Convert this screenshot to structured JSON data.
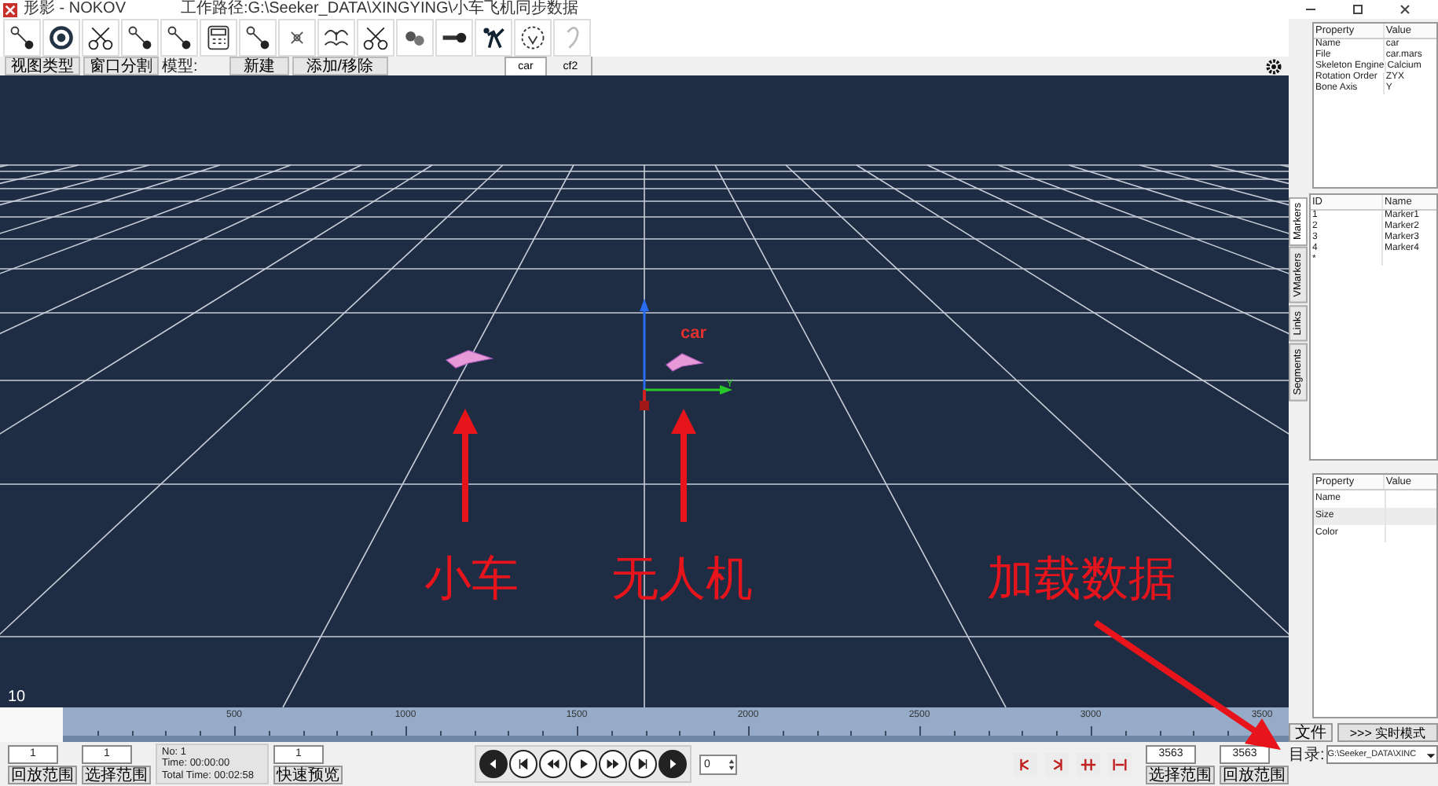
{
  "window": {
    "title": "形影 - NOKOV",
    "path": "工作路径:G:\\Seeker_DATA\\XINGYING\\小车飞机同步数据"
  },
  "menu_bar": [
    {
      "label": "视图类型"
    },
    {
      "label": "窗口分割"
    }
  ],
  "model": {
    "label": "模型:",
    "buttons": [
      "新建",
      "添加/移除"
    ]
  },
  "tabs": [
    {
      "label": "car",
      "selected": true
    },
    {
      "label": "cf2",
      "selected": false
    }
  ],
  "viewport": {
    "object_label": "car",
    "axis_label": "Y",
    "frame_number": "10"
  },
  "annotations": [
    {
      "text": "小车"
    },
    {
      "text": "无人机"
    },
    {
      "text": "加载数据"
    }
  ],
  "timeline": {
    "ticks": [
      "500",
      "1000",
      "1500",
      "2000",
      "2500",
      "3000",
      "3500"
    ]
  },
  "playback": {
    "range_start": "1",
    "select_start": "1",
    "range_button": "回放范围",
    "select_button": "选择范围",
    "info": [
      "No: 1",
      "Time: 00:00:00",
      "Total Time: 00:02:58"
    ],
    "speed": "1",
    "preview_button": "快速预览",
    "spin": "0",
    "select_end": "3563",
    "range_end": "3563",
    "end_select_button": "选择范围",
    "end_range_button": "回放范围"
  },
  "properties": {
    "columns": [
      "Property",
      "Value"
    ],
    "rows": [
      [
        "Name",
        "car"
      ],
      [
        "File",
        "car.mars"
      ],
      [
        "Skeleton Engine",
        "Calcium"
      ],
      [
        "Rotation Order",
        "ZYX"
      ],
      [
        "Bone Axis",
        "Y"
      ]
    ]
  },
  "markers": {
    "columns": [
      "ID",
      "Name"
    ],
    "rows": [
      [
        "1",
        "Marker1"
      ],
      [
        "2",
        "Marker2"
      ],
      [
        "3",
        "Marker3"
      ],
      [
        "4",
        "Marker4"
      ]
    ],
    "new_row": "*"
  },
  "side_tabs": [
    {
      "label": "Markers",
      "selected": true
    },
    {
      "label": "VMarkers",
      "selected": false
    },
    {
      "label": "Links",
      "selected": false
    },
    {
      "label": "Segments",
      "selected": false
    }
  ],
  "segment": {
    "columns": [
      "Property",
      "Value"
    ],
    "rows": [
      "Name",
      "Size",
      "Color"
    ]
  },
  "file_button": "文件",
  "realtime_button": ">>> 实时模式",
  "directory": {
    "label": "目录:",
    "value": "G:\\Seeker_DATA\\XINC"
  }
}
